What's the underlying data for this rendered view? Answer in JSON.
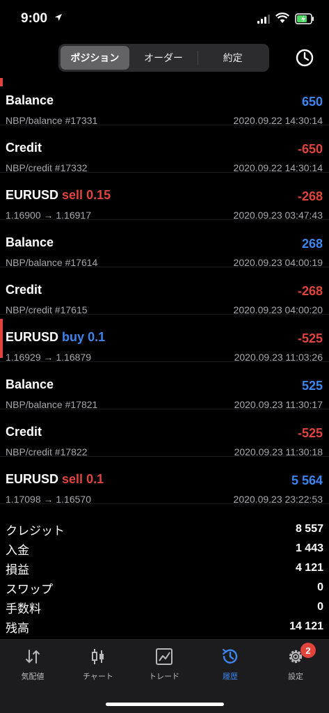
{
  "status_bar": {
    "time": "9:00"
  },
  "segments": [
    {
      "label": "ポジション",
      "active": true
    },
    {
      "label": "オーダー",
      "active": false
    },
    {
      "label": "約定",
      "active": false
    }
  ],
  "history_rows": [
    {
      "title": "Balance",
      "side": "",
      "volume": "",
      "sub": "NBP/balance #17331",
      "amount": "650",
      "amount_sign": "pos",
      "date": "2020.09.22 14:30:14"
    },
    {
      "title": "Credit",
      "side": "",
      "volume": "",
      "sub": "NBP/credit #17332",
      "amount": "-650",
      "amount_sign": "neg",
      "date": "2020.09.22 14:30:14"
    },
    {
      "title": "EURUSD",
      "side": "sell",
      "volume": "0.15",
      "sub": "1.16900 → 1.16917",
      "amount": "-268",
      "amount_sign": "neg",
      "date": "2020.09.23 03:47:43"
    },
    {
      "title": "Balance",
      "side": "",
      "volume": "",
      "sub": "NBP/balance #17614",
      "amount": "268",
      "amount_sign": "pos",
      "date": "2020.09.23 04:00:19"
    },
    {
      "title": "Credit",
      "side": "",
      "volume": "",
      "sub": "NBP/credit #17615",
      "amount": "-268",
      "amount_sign": "neg",
      "date": "2020.09.23 04:00:20"
    },
    {
      "title": "EURUSD",
      "side": "buy",
      "volume": "0.1",
      "sub": "1.16929 → 1.16879",
      "amount": "-525",
      "amount_sign": "neg",
      "date": "2020.09.23 11:03:26"
    },
    {
      "title": "Balance",
      "side": "",
      "volume": "",
      "sub": "NBP/balance #17821",
      "amount": "525",
      "amount_sign": "pos",
      "date": "2020.09.23 11:30:17"
    },
    {
      "title": "Credit",
      "side": "",
      "volume": "",
      "sub": "NBP/credit #17822",
      "amount": "-525",
      "amount_sign": "neg",
      "date": "2020.09.23 11:30:18"
    },
    {
      "title": "EURUSD",
      "side": "sell",
      "volume": "0.1",
      "sub": "1.17098 → 1.16570",
      "amount": "5 564",
      "amount_sign": "pos",
      "date": "2020.09.23 23:22:53"
    }
  ],
  "summary": [
    {
      "label": "クレジット",
      "value": "8 557"
    },
    {
      "label": "入金",
      "value": "1 443"
    },
    {
      "label": "損益",
      "value": "4 121"
    },
    {
      "label": "スワップ",
      "value": "0"
    },
    {
      "label": "手数料",
      "value": "0"
    },
    {
      "label": "残高",
      "value": "14 121"
    }
  ],
  "tabs": [
    {
      "label": "気配値",
      "icon": "quotes-arrows-icon",
      "active": false
    },
    {
      "label": "チャート",
      "icon": "candlestick-icon",
      "active": false
    },
    {
      "label": "トレード",
      "icon": "trade-chart-icon",
      "active": false
    },
    {
      "label": "履歴",
      "icon": "history-clock-icon",
      "active": true
    },
    {
      "label": "設定",
      "icon": "gear-icon",
      "active": false,
      "badge": "2"
    }
  ],
  "colors": {
    "accent_blue": "#3d86f0",
    "negative_red": "#e0443c"
  }
}
